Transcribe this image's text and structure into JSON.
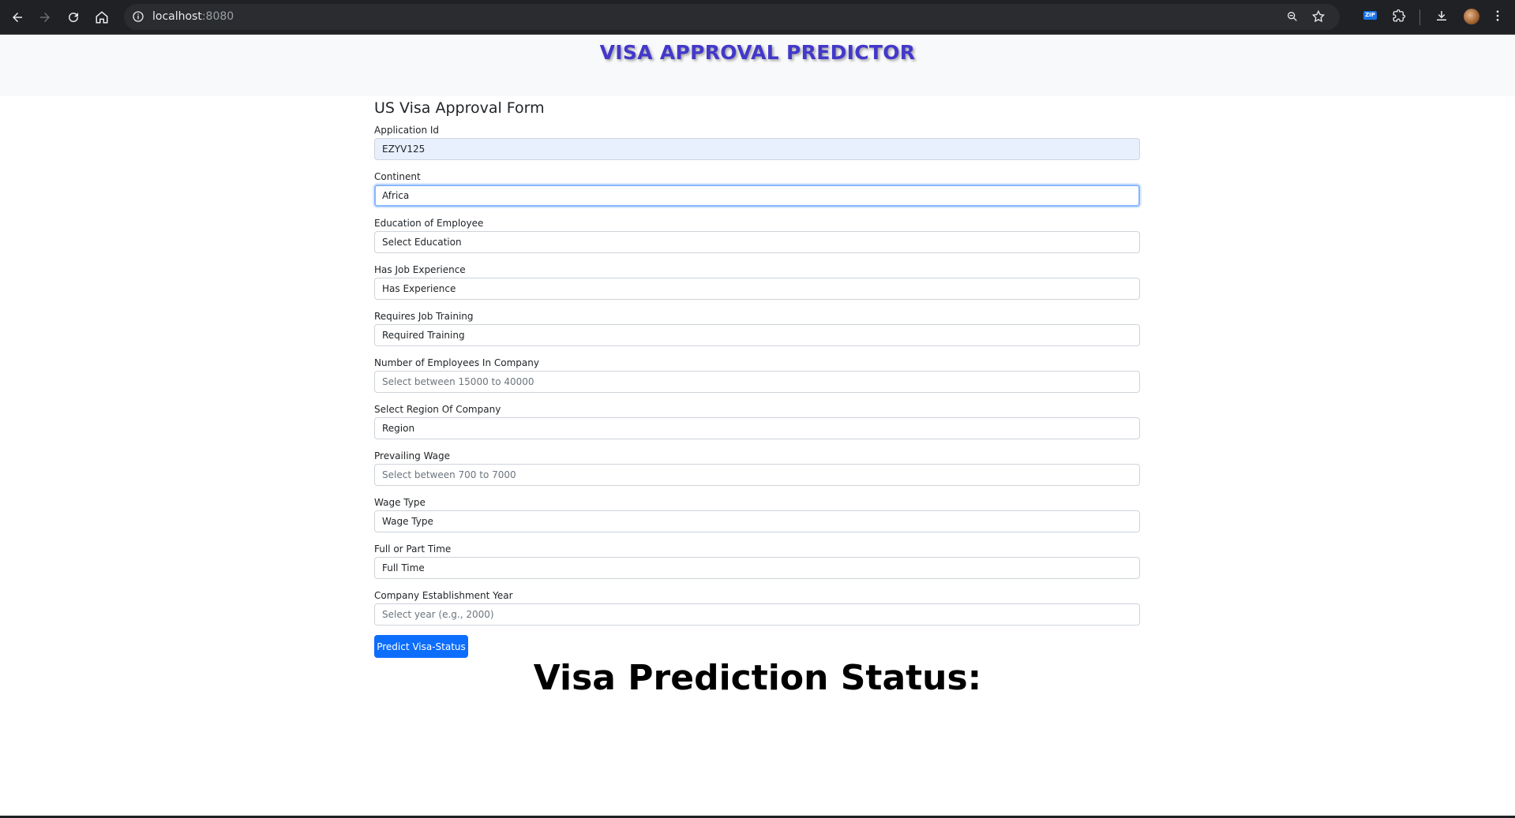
{
  "browser": {
    "url_host": "localhost",
    "url_port": ":8080",
    "zip_badge": "ZIP"
  },
  "page": {
    "app_title": "VISA APPROVAL PREDICTOR",
    "form_title": "US Visa Approval Form",
    "fields": [
      {
        "label": "Application Id",
        "value": "EZYV125",
        "kind": "value"
      },
      {
        "label": "Continent",
        "value": "Africa",
        "kind": "value"
      },
      {
        "label": "Education of Employee",
        "value": "Select Education",
        "kind": "select"
      },
      {
        "label": "Has Job Experience",
        "value": "Has Experience",
        "kind": "select"
      },
      {
        "label": "Requires Job Training",
        "value": "Required Training",
        "kind": "select"
      },
      {
        "label": "Number of Employees In Company",
        "value": "Select between 15000 to 40000",
        "kind": "placeholder"
      },
      {
        "label": "Select Region Of Company",
        "value": "Region",
        "kind": "select"
      },
      {
        "label": "Prevailing Wage",
        "value": "Select between 700 to 7000",
        "kind": "placeholder"
      },
      {
        "label": "Wage Type",
        "value": "Wage Type",
        "kind": "select"
      },
      {
        "label": "Full or Part Time",
        "value": "Full Time",
        "kind": "select"
      },
      {
        "label": "Company Establishment Year",
        "value": "Select year (e.g., 2000)",
        "kind": "placeholder"
      }
    ],
    "predict_button": "Predict Visa-Status",
    "status_heading": "Visa Prediction Status:"
  }
}
